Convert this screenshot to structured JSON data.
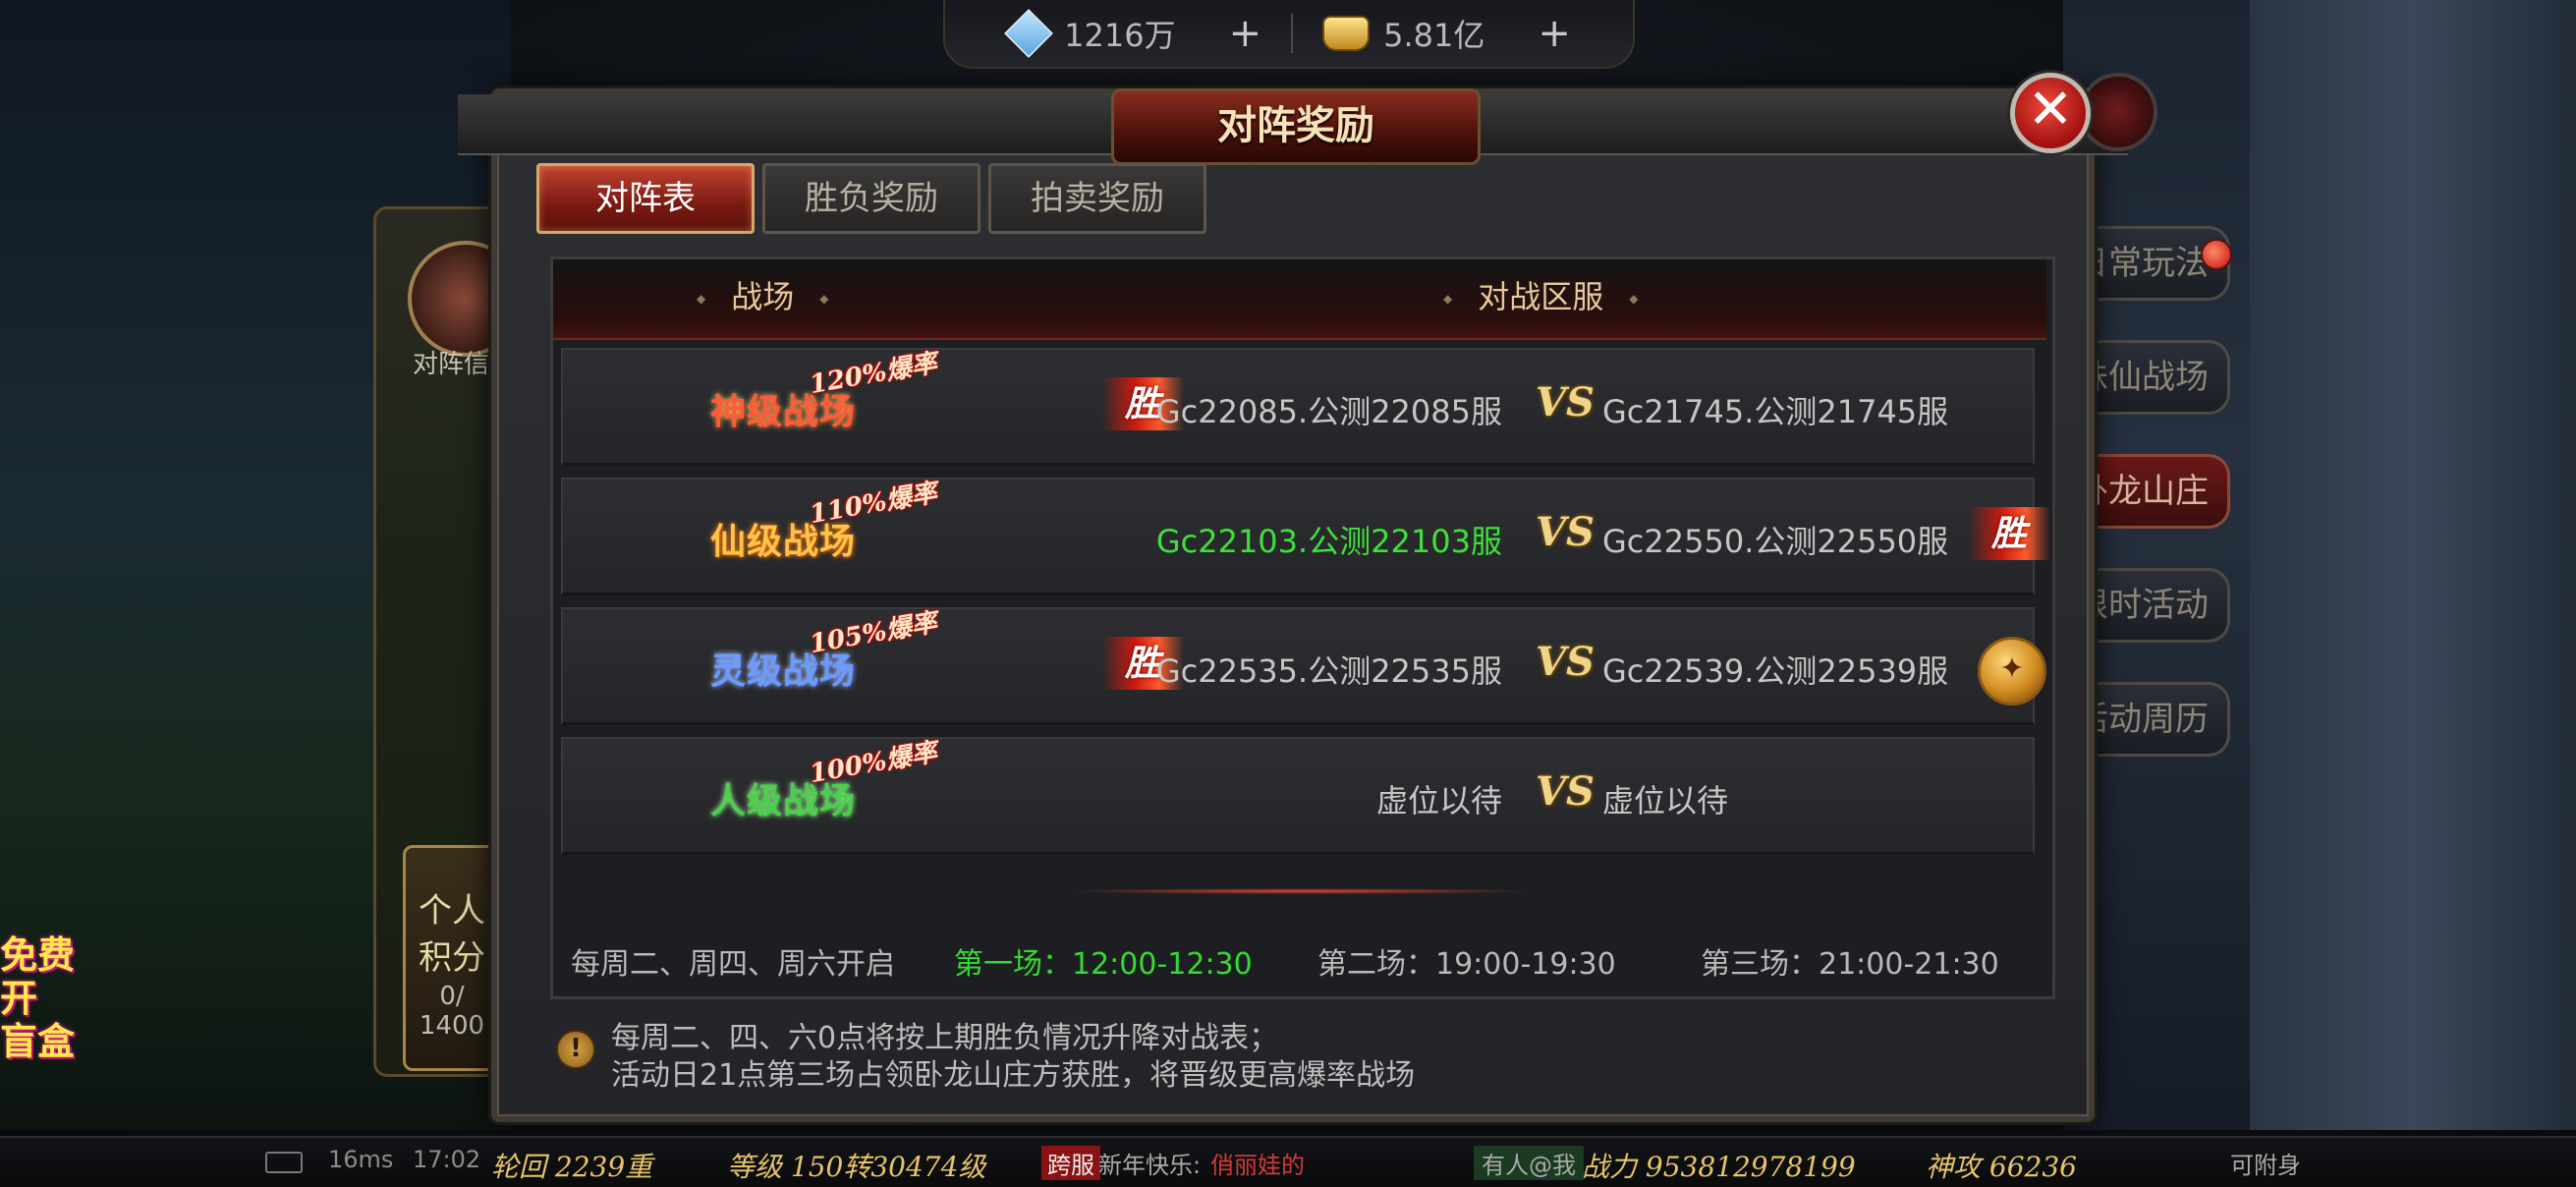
{
  "topbar": {
    "diamond_amount": "1216万",
    "gold_amount": "5.81亿",
    "plus_symbol": "+"
  },
  "background": {
    "left_panel_label": "对阵信",
    "personal_label_1": "个人",
    "personal_label_2": "积分",
    "personal_score": "0/",
    "personal_total": "1400",
    "promo_lines": [
      "免费",
      "开",
      "盲盒"
    ],
    "side_menu": [
      "日常玩法",
      "诛仙战场",
      "卧龙山庄",
      "限时活动",
      "活动周历"
    ],
    "side_menu_active_index": 2
  },
  "dialog": {
    "title": "对阵奖励",
    "close_symbol": "✕",
    "tabs": [
      "对阵表",
      "胜负奖励",
      "拍卖奖励"
    ],
    "active_tab_index": 0,
    "table": {
      "headers": [
        "战场",
        "对战区服"
      ],
      "vs_label": "VS",
      "win_label": "胜",
      "rows": [
        {
          "arena": "神级战场",
          "bonus": "120%爆率",
          "left": "Gc22085.公测22085服",
          "right": "Gc21745.公测21745服",
          "winner": "left",
          "arena_color": "#ff4a3a"
        },
        {
          "arena": "仙级战场",
          "bonus": "110%爆率",
          "left": "Gc22103.公测22103服",
          "right": "Gc22550.公测22550服",
          "winner": "right",
          "arena_color": "#ffb845",
          "left_highlight": true
        },
        {
          "arena": "灵级战场",
          "bonus": "105%爆率",
          "left": "Gc22535.公测22535服",
          "right": "Gc22539.公测22539服",
          "winner": "left",
          "arena_color": "#5a8cff",
          "right_badge": "medal"
        },
        {
          "arena": "人级战场",
          "bonus": "100%爆率",
          "left": "虚位以待",
          "right": "虚位以待",
          "winner": "none",
          "arena_color": "#4ad04a"
        }
      ]
    },
    "schedule": {
      "open_days": "每周二、周四、周六开启",
      "first": "第一场：12:00-12:30",
      "second": "第二场：19:00-19:30",
      "third": "第三场：21:00-21:30",
      "first_color": "#34d933"
    },
    "notice": {
      "icon": "!",
      "line1": "每周二、四、六0点将按上期胜负情况升降对战表；",
      "line2": "活动日21点第三场占领卧龙山庄方获胜，将晋级更高爆率战场"
    }
  },
  "statusbar": {
    "ping": "16ms",
    "time": "17:02",
    "reincarnation": "轮回 2239重",
    "level": "等级 150转30474级",
    "channel_badge": "跨服",
    "chat_text": "新年快乐:",
    "chat_name": "俏丽娃的",
    "mention": "有人@我",
    "combat_power": "战力 953812978199",
    "divine_power": "神攻 66236",
    "attach": "可附身"
  }
}
